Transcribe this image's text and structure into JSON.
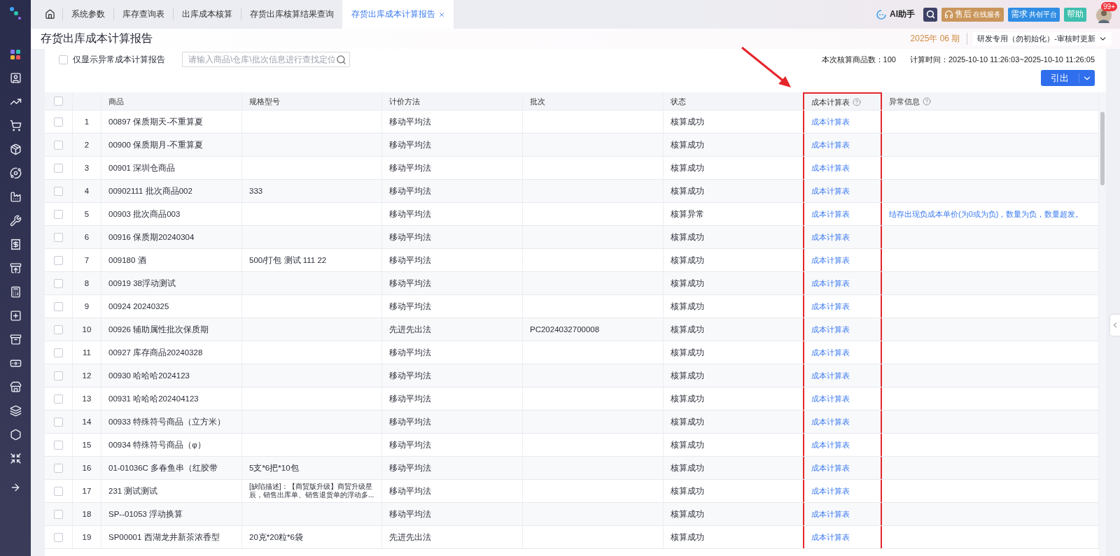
{
  "tabs": [
    {
      "label": "系统参数",
      "selected": false,
      "closable": false
    },
    {
      "label": "库存查询表",
      "selected": false,
      "closable": false
    },
    {
      "label": "出库成本核算",
      "selected": false,
      "closable": false
    },
    {
      "label": "存货出库核算结果查询",
      "selected": false,
      "closable": false
    },
    {
      "label": "存货出库成本计算报告",
      "selected": true,
      "closable": true
    }
  ],
  "header_tools": {
    "ai_label": "AI助手",
    "buttons": [
      {
        "kind": "service",
        "main": "售后",
        "sub": "在线服务",
        "color": "#c9955a"
      },
      {
        "kind": "plain",
        "main": "需求",
        "sub": "共创平台",
        "color": "#2f8de4"
      },
      {
        "kind": "plain",
        "main": "帮助",
        "color": "#3fbfae"
      }
    ],
    "notification_badge": "99+"
  },
  "page": {
    "title": "存货出库成本计算报告",
    "period": "2025年 06 期",
    "org_selector": "研发专用（勿初始化）-审核时更新"
  },
  "toolbar": {
    "filter": {
      "label": "仅显示异常成本计算报告",
      "checked": false
    },
    "search": {
      "placeholder": "请输入商品\\仓库\\批次信息进行查找定位"
    },
    "count": "本次核算商品数：100",
    "calc_time": "计算时间：2025-10-10 11:26:03~2025-10-10 11:26:05",
    "export_button": "引出"
  },
  "table": {
    "all_checked": false,
    "columns": [
      {
        "label": "商品",
        "help": false,
        "highlighted": false
      },
      {
        "label": "规格型号",
        "help": false,
        "highlighted": false
      },
      {
        "label": "计价方法",
        "help": false,
        "highlighted": false
      },
      {
        "label": "批次",
        "help": false,
        "highlighted": false
      },
      {
        "label": "状态",
        "help": false,
        "highlighted": false
      },
      {
        "label": "成本计算表",
        "help": true,
        "highlighted": true
      },
      {
        "label": "异常信息",
        "help": true,
        "highlighted": false
      }
    ],
    "rows": [
      {
        "index": "1",
        "product": "00897 保质期天-不重算夏",
        "method": "移动平均法",
        "status": "核算成功",
        "link": "成本计算表",
        "checked": false
      },
      {
        "index": "2",
        "product": "00900 保质期月-不重算夏",
        "method": "移动平均法",
        "status": "核算成功",
        "link": "成本计算表",
        "checked": false
      },
      {
        "index": "3",
        "product": "00901 深圳仓商品",
        "method": "移动平均法",
        "status": "核算成功",
        "link": "成本计算表",
        "checked": false
      },
      {
        "index": "4",
        "product": "00902111 批次商品002",
        "spec": "333",
        "method": "移动平均法",
        "status": "核算成功",
        "link": "成本计算表",
        "checked": false
      },
      {
        "index": "5",
        "product": "00903 批次商品003",
        "method": "移动平均法",
        "status": "核算异常",
        "link": "成本计算表",
        "message": "结存出现负成本单价(为0或为负)，数量为负，数量超发。",
        "checked": false
      },
      {
        "index": "6",
        "product": "00916 保质期20240304",
        "method": "移动平均法",
        "status": "核算成功",
        "link": "成本计算表",
        "checked": false
      },
      {
        "index": "7",
        "product": "009180 酒",
        "spec": "500/打包 测试 111 22",
        "method": "移动平均法",
        "status": "核算成功",
        "link": "成本计算表",
        "checked": false
      },
      {
        "index": "8",
        "product": "00919 38浮动测试",
        "method": "移动平均法",
        "status": "核算成功",
        "link": "成本计算表",
        "checked": false
      },
      {
        "index": "9",
        "product": "00924 20240325",
        "method": "移动平均法",
        "status": "核算成功",
        "link": "成本计算表",
        "checked": false
      },
      {
        "index": "10",
        "product": "00926 辅助属性批次保质期",
        "method": "先进先出法",
        "batch": "PC2024032700008",
        "status": "核算成功",
        "link": "成本计算表",
        "checked": false
      },
      {
        "index": "11",
        "product": "00927 库存商品20240328",
        "method": "移动平均法",
        "status": "核算成功",
        "link": "成本计算表",
        "checked": false
      },
      {
        "index": "12",
        "product": "00930 哈哈哈2024123",
        "method": "移动平均法",
        "status": "核算成功",
        "link": "成本计算表",
        "checked": false
      },
      {
        "index": "13",
        "product": "00931 哈哈哈202404123",
        "method": "移动平均法",
        "status": "核算成功",
        "link": "成本计算表",
        "checked": false
      },
      {
        "index": "14",
        "product": "00933 特殊符号商品（立方米）",
        "method": "移动平均法",
        "status": "核算成功",
        "link": "成本计算表",
        "checked": false
      },
      {
        "index": "15",
        "product": "00934 特殊符号商品（φ）",
        "method": "移动平均法",
        "status": "核算成功",
        "link": "成本计算表",
        "checked": false
      },
      {
        "index": "16",
        "product": "01-01036C 多春鱼串（红胶带",
        "spec": "5支*6把*10包",
        "method": "移动平均法",
        "status": "核算成功",
        "link": "成本计算表",
        "checked": false
      },
      {
        "index": "17",
        "product": "231 测试测试",
        "spec": "[缺陷描述]：【商贸版升级】商贸升级星辰，销售出库单、销售退货单的浮动多...",
        "method": "移动平均法",
        "status": "核算成功",
        "link": "成本计算表",
        "checked": false
      },
      {
        "index": "18",
        "product": "SP--01053 浮动换算",
        "method": "移动平均法",
        "status": "核算成功",
        "link": "成本计算表",
        "checked": false
      },
      {
        "index": "19",
        "product": "SP00001 西湖龙井新茶浓香型",
        "spec": "20克*20粒*6袋",
        "method": "先进先出法",
        "status": "核算成功",
        "link": "成本计算表",
        "checked": false
      }
    ]
  }
}
